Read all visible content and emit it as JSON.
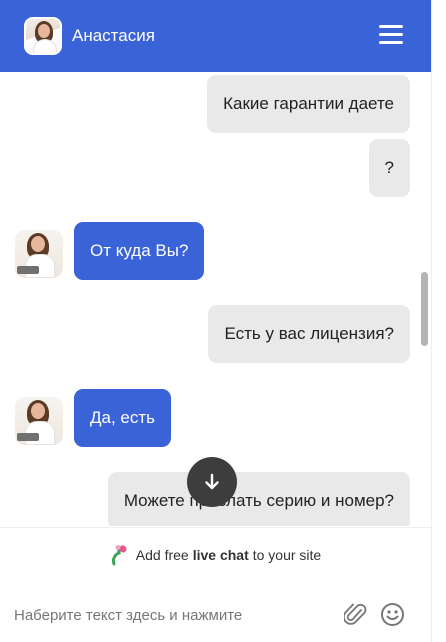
{
  "header": {
    "title": "Анастасия",
    "avatar_icon": "operator-avatar",
    "menu_icon": "hamburger-menu-icon"
  },
  "messages": [
    {
      "side": "out",
      "text": "Какие гарантии даете"
    },
    {
      "side": "out",
      "text": "?"
    },
    {
      "side": "in",
      "text": "От куда Вы?"
    },
    {
      "side": "out",
      "text": "Есть у вас лицензия?"
    },
    {
      "side": "in",
      "text": "Да, есть"
    },
    {
      "side": "out",
      "text": "Можете прислать серию и номер?"
    }
  ],
  "scroll_down_icon": "arrow-down-icon",
  "promo": {
    "prefix": "Add free",
    "bold": "live chat",
    "suffix": "to your site",
    "icon": "chat-logo-icon"
  },
  "composer": {
    "placeholder": "Наберите текст здесь и нажмите",
    "attach_icon": "paperclip-icon",
    "emoji_icon": "smiley-icon"
  },
  "colors": {
    "accent": "#3a63d8",
    "outgoing_bubble": "#e9e9e9",
    "scroll_button": "#3d3d3d"
  }
}
